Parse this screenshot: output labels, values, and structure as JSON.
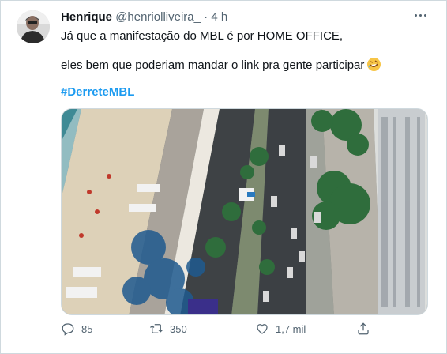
{
  "tweet": {
    "author_name": "Henrique",
    "author_handle": "@henriolliveira_",
    "separator": "·",
    "time": "4 h",
    "line1": "Já que a manifestação do MBL é por HOME OFFICE,",
    "line2": "eles bem que poderiam mandar o link pra gente participar",
    "emoji_name": "rolling-on-floor-laughing-emoji",
    "hashtag": "#DerreteMBL"
  },
  "actions": {
    "reply_count": "85",
    "retweet_count": "350",
    "like_count": "1,7 mil"
  },
  "colors": {
    "text": "#0f1419",
    "muted": "#536471",
    "link": "#1d9bf0",
    "border": "#cfd9de"
  },
  "icons": [
    "more-icon",
    "reply-icon",
    "retweet-icon",
    "like-icon",
    "share-icon"
  ]
}
